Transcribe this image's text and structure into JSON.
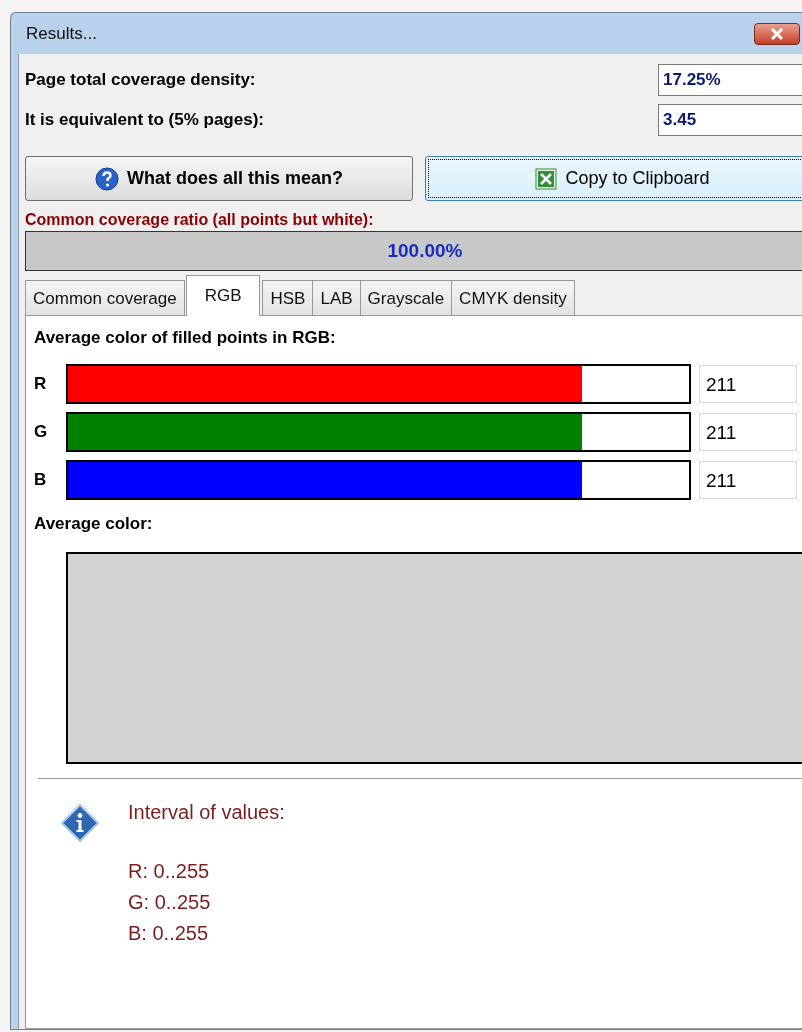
{
  "window": {
    "title": "Results..."
  },
  "fields": [
    {
      "label": "Page total coverage density:",
      "value": "17.25%"
    },
    {
      "label": "It is equivalent to (5% pages):",
      "value": "3.45"
    }
  ],
  "buttons": [
    {
      "label": "What does all this mean?",
      "kind": "help",
      "focused": false
    },
    {
      "label": "Copy to Clipboard",
      "kind": "excel",
      "focused": true
    }
  ],
  "coverage": {
    "label": "Common coverage ratio (all points but white):",
    "level": 1,
    "reading": "100.00%"
  },
  "tabs": [
    {
      "label": "Common coverage",
      "selected": false
    },
    {
      "label": "RGB",
      "selected": true
    },
    {
      "label": "HSB",
      "selected": false
    },
    {
      "label": "LAB",
      "selected": false
    },
    {
      "label": "Grayscale",
      "selected": false
    },
    {
      "label": "CMYK density",
      "selected": false
    }
  ],
  "panel": {
    "heading": "Average color of filled points in RGB:",
    "channels": [
      {
        "name": "R",
        "color": "#ff0000",
        "level": 0.827,
        "reading": "211"
      },
      {
        "name": "G",
        "color": "#008000",
        "level": 0.827,
        "reading": "211"
      },
      {
        "name": "B",
        "color": "#0000ff",
        "level": 0.827,
        "reading": "211"
      }
    ],
    "average": {
      "label": "Average color:",
      "color": "#d3d3d3"
    },
    "info": {
      "title": "Interval of values:",
      "lines": [
        "R: 0..255",
        "G: 0..255",
        "B: 0..255"
      ]
    }
  }
}
